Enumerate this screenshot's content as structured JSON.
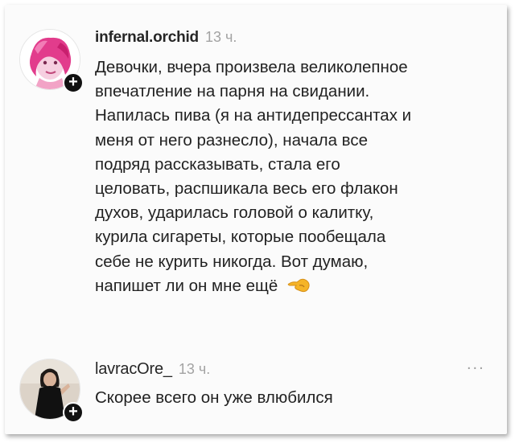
{
  "comments": [
    {
      "username": "infernal.orchid",
      "time": "13 ч.",
      "text": "Девочки, вчера произвела великолепное\nвпечатление на парня на свидании.\nНапилась пива (я на антидепрессантах и\nменя от него разнесло), начала все\nподряд рассказывать, стала его\nцеловать, распшикала весь его флакон\nдухов, ударилась головой о калитку,\nкурила сигареты, которые пообещала\nсебе не курить никогда. Вот думаю,\nнапишет ли он мне ещё",
      "emoji": "pointing-left-hand-emoji"
    },
    {
      "username": "lavracOre_",
      "time": "13 ч.",
      "text": "Скорее всего он уже влюбился",
      "more": "..."
    }
  ],
  "badge_symbol": "+",
  "colors": {
    "username": "#262626",
    "time": "#a3a3a3",
    "text": "#222222",
    "badge": "#111111",
    "emoji": "#f5b428"
  }
}
